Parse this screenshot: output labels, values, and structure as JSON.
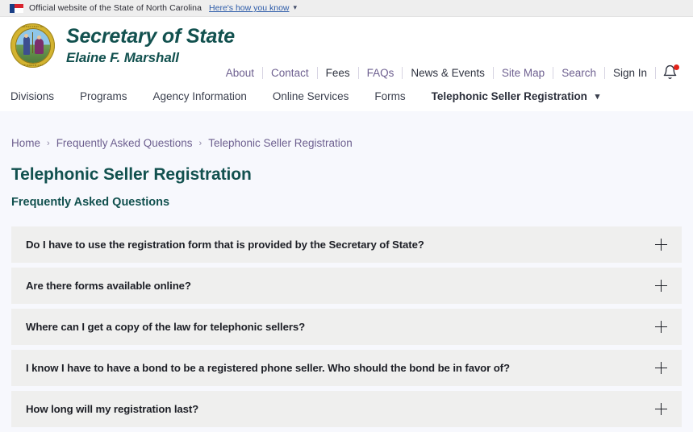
{
  "gov_banner": {
    "flag_icon": "nc-flag-icon",
    "text": "Official website of the State of North Carolina",
    "link_label": "Here's how you know",
    "chevron_icon": "chevron-down-icon"
  },
  "header": {
    "seal_icon": "nc-state-seal-icon",
    "seal_ring_top": "THE GREAT SEAL OF THE",
    "seal_ring_bottom": "STATE OF NORTH CAROLINA",
    "brand_title": "Secretary of State",
    "brand_subtitle": "Elaine F. Marshall",
    "utility_nav": [
      {
        "label": "About"
      },
      {
        "label": "Contact"
      },
      {
        "label": "Fees"
      },
      {
        "label": "FAQs"
      },
      {
        "label": "News & Events"
      },
      {
        "label": "Site Map"
      },
      {
        "label": "Search"
      },
      {
        "label": "Sign In"
      }
    ],
    "notification_icon": "bell-icon",
    "notification_badge_color": "#e2231a"
  },
  "main_nav": {
    "items": [
      {
        "label": "Divisions"
      },
      {
        "label": "Programs"
      },
      {
        "label": "Agency Information"
      },
      {
        "label": "Online Services"
      },
      {
        "label": "Forms"
      }
    ],
    "active_item": {
      "label": "Telephonic Seller Registration",
      "chevron_icon": "chevron-down-icon"
    }
  },
  "breadcrumb": {
    "separator": "›",
    "items": [
      {
        "label": "Home"
      },
      {
        "label": "Frequently Asked Questions"
      },
      {
        "label": "Telephonic Seller Registration"
      }
    ]
  },
  "main": {
    "title": "Telephonic Seller Registration",
    "subtitle": "Frequently Asked Questions",
    "faq_items": [
      {
        "question": "Do I have to use the registration form that is provided by the Secretary of State?",
        "toggle_icon": "plus-icon"
      },
      {
        "question": "Are there forms available online?",
        "toggle_icon": "plus-icon"
      },
      {
        "question": "Where can I get a copy of the law for telephonic sellers?",
        "toggle_icon": "plus-icon"
      },
      {
        "question": "I know I have to have a bond to be a registered phone seller. Who should the bond be in favor of?",
        "toggle_icon": "plus-icon"
      },
      {
        "question": "How long will my registration last?",
        "toggle_icon": "plus-icon"
      }
    ]
  },
  "colors": {
    "brand_teal": "#12514f",
    "link_purple": "#6d5f8f",
    "page_background": "#f7f8fd",
    "accordion_background": "#efefee",
    "banner_background": "#eeeeee"
  }
}
